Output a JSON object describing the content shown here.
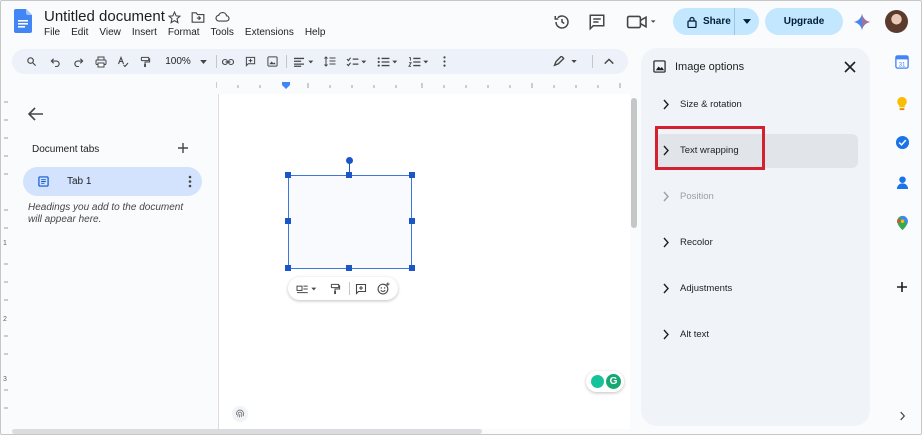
{
  "app": {
    "doc_title": "Untitled document",
    "menu": [
      "File",
      "Edit",
      "View",
      "Insert",
      "Format",
      "Tools",
      "Extensions",
      "Help"
    ]
  },
  "header": {
    "share_label": "Share",
    "upgrade_label": "Upgrade"
  },
  "toolbar": {
    "zoom": "100%"
  },
  "tabs_panel": {
    "section_label": "Document tabs",
    "tab_label": "Tab 1",
    "hint": "Headings you add to the document will appear here."
  },
  "image_options": {
    "title": "Image options",
    "items": [
      {
        "label": "Size & rotation",
        "state": "normal"
      },
      {
        "label": "Text wrapping",
        "state": "active"
      },
      {
        "label": "Position",
        "state": "disabled"
      },
      {
        "label": "Recolor",
        "state": "normal"
      },
      {
        "label": "Adjustments",
        "state": "normal"
      },
      {
        "label": "Alt text",
        "state": "normal"
      }
    ]
  },
  "ruler": {
    "left_marks": [
      "1",
      "2",
      "3"
    ]
  },
  "sidebar_right": {
    "calendar_day": "31"
  },
  "colors": {
    "accent": "#c2e7ff",
    "selection": "#1a56c7",
    "highlight": "#d3212f",
    "tab_active": "#d3e3fd"
  }
}
